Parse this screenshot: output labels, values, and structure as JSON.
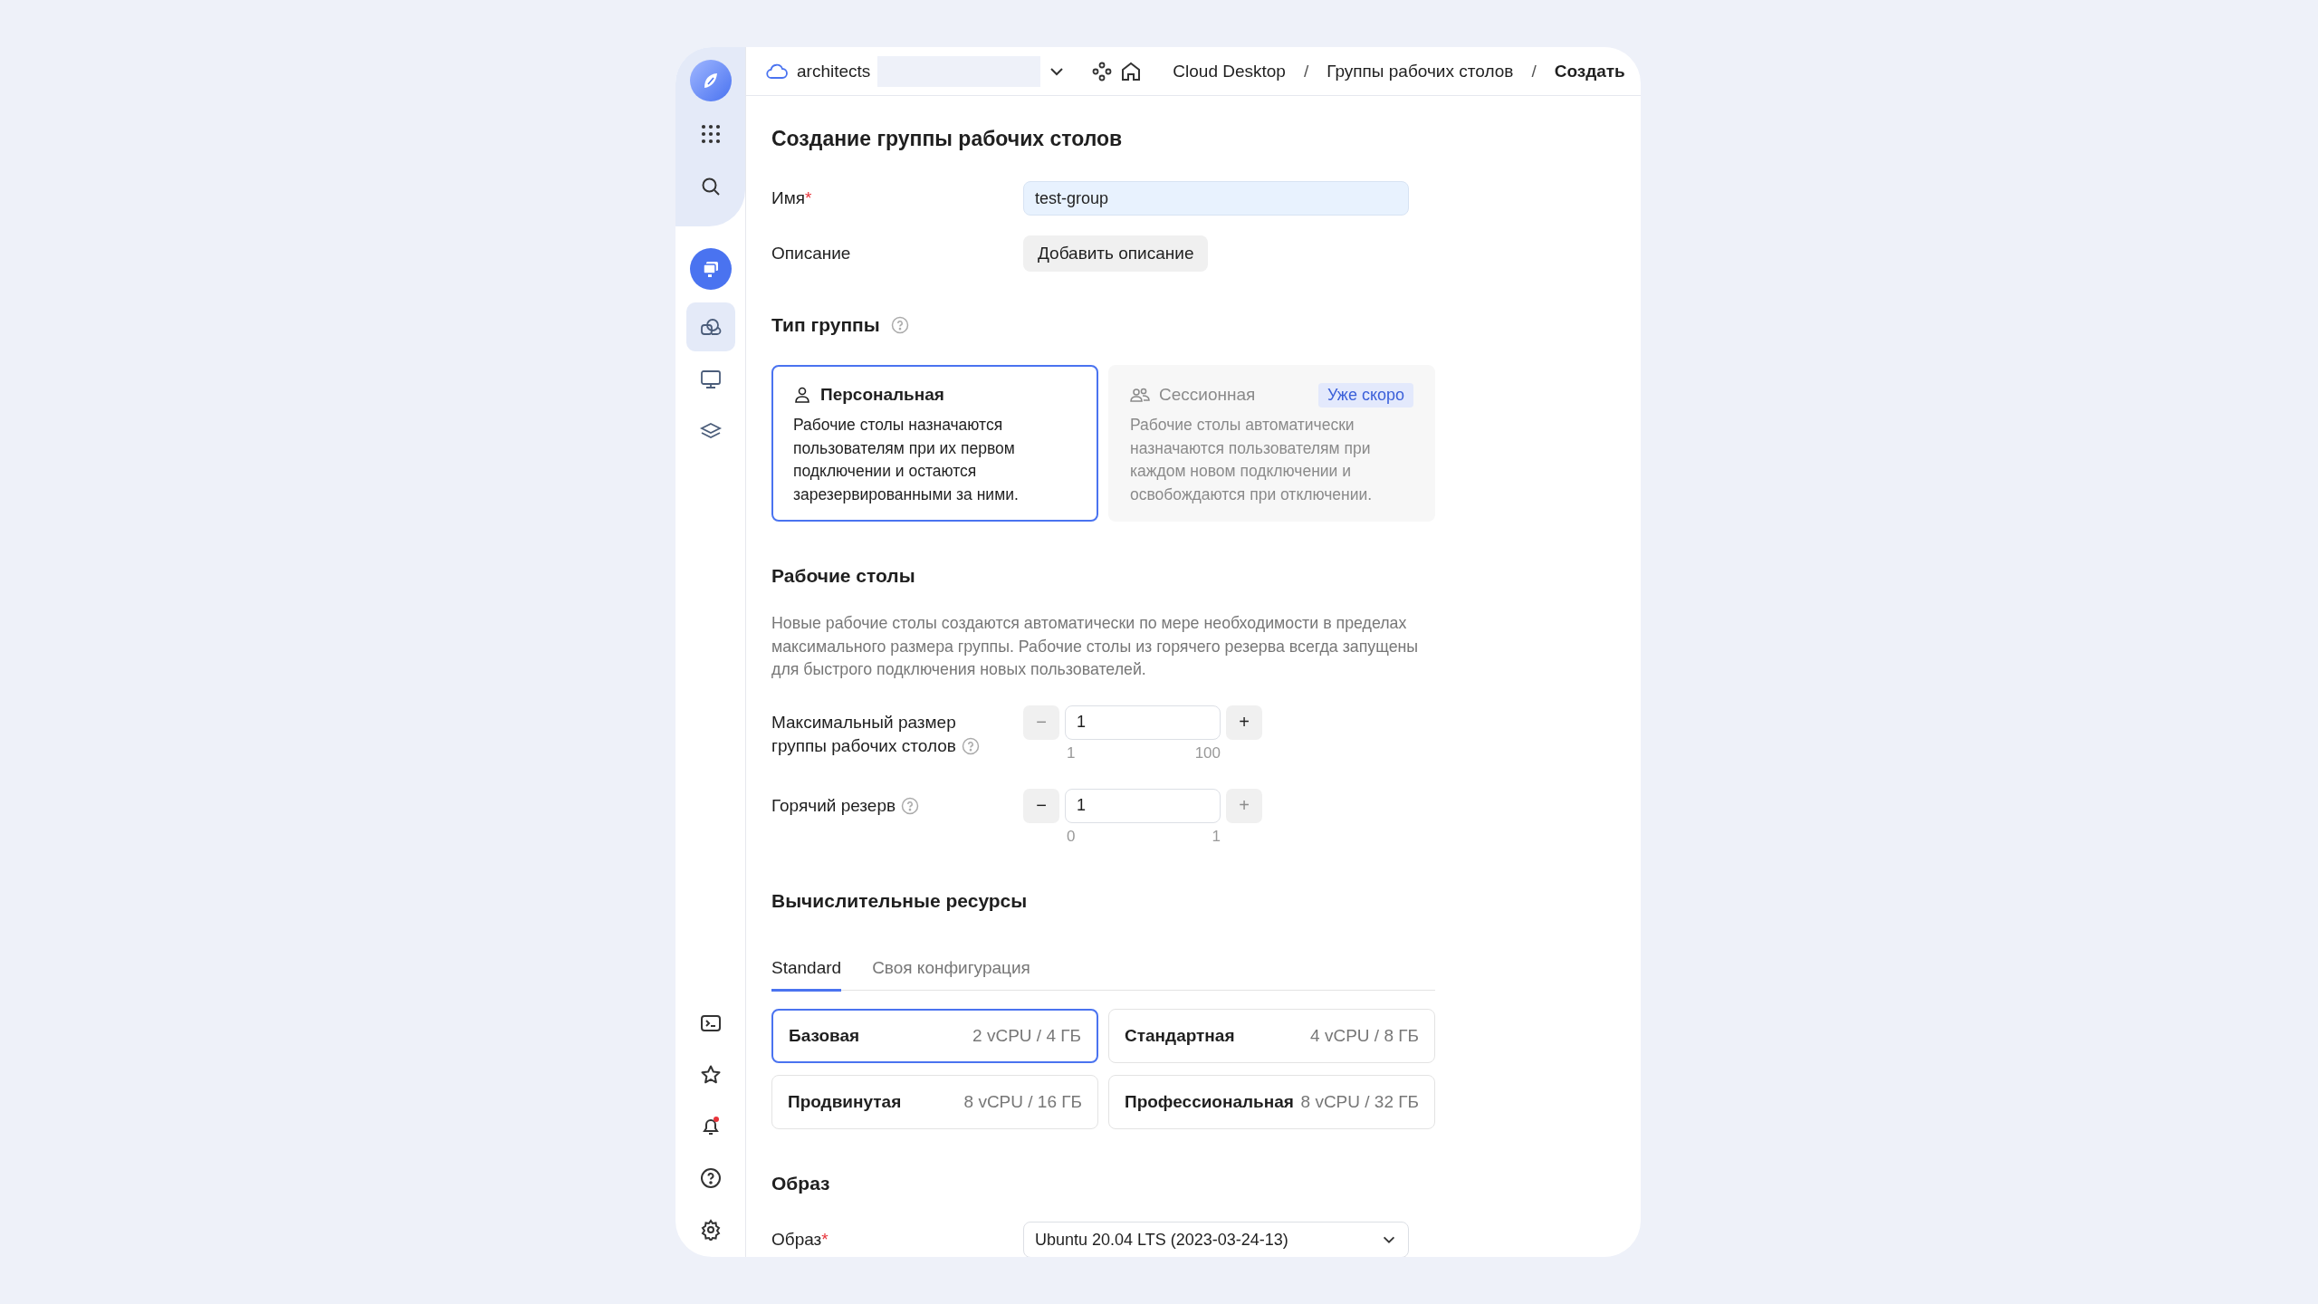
{
  "sidebar": {
    "nav_items": [
      {
        "selected": true
      },
      {
        "selected": false
      },
      {
        "selected": false
      }
    ]
  },
  "top_bar": {
    "folder": "architects",
    "breadcrumbs": [
      {
        "label": "Cloud Desktop",
        "current": false
      },
      {
        "separator": "/",
        "label": "Группы рабочих столов",
        "current": false
      },
      {
        "separator": "/",
        "label": "Создать",
        "current": true
      }
    ]
  },
  "title": "Создание группы рабочих столов",
  "name_field": {
    "label": "Имя",
    "required_mark": "*",
    "value": "test-group"
  },
  "description_field": {
    "label": "Описание",
    "button": "Добавить описание"
  },
  "group_type": {
    "title": "Тип группы",
    "options": [
      {
        "title": "Персональная",
        "description": "Рабочие столы назначаются пользователям при их первом подключении и остаются зарезервированными за ними.",
        "selected": true,
        "disabled": false
      },
      {
        "title": "Сессионная",
        "badge": "Уже скоро",
        "description": "Рабочие столы автоматически назначаются пользователям при каждом новом подключении и освобождаются при отключении.",
        "selected": false,
        "disabled": true
      }
    ]
  },
  "desktops": {
    "title": "Рабочие столы",
    "description": "Новые рабочие столы создаются автоматически по мере необходимости в пределах максимального размера группы. Рабочие столы из горячего резерва всегда запущены для быстрого подключения новых пользователей.",
    "steppers": [
      {
        "label": "Максимальный размер группы рабочих столов",
        "value": "1",
        "minus": "−",
        "plus": "+",
        "minus_disabled": true,
        "plus_disabled": false,
        "min_label": "1",
        "max_label": "100"
      },
      {
        "label": "Горячий резерв",
        "value": "1",
        "minus": "−",
        "plus": "+",
        "minus_disabled": false,
        "plus_disabled": true,
        "min_label": "0",
        "max_label": "1"
      }
    ]
  },
  "resources": {
    "title": "Вычислительные ресурсы",
    "tabs": [
      {
        "label": "Standard",
        "selected": true
      },
      {
        "label": "Своя конфигурация",
        "selected": false
      }
    ],
    "presets": [
      {
        "name": "Базовая",
        "spec": "2 vCPU / 4 ГБ",
        "selected": true
      },
      {
        "name": "Стандартная",
        "spec": "4 vCPU / 8 ГБ",
        "selected": false
      },
      {
        "name": "Продвинутая",
        "spec": "8 vCPU / 16 ГБ",
        "selected": false
      },
      {
        "name": "Профессиональная",
        "spec": "8 vCPU / 32 ГБ",
        "selected": false
      }
    ]
  },
  "image": {
    "title": "Образ",
    "label": "Образ",
    "required_mark": "*",
    "value": "Ubuntu 20.04 LTS (2023-03-24-13)"
  }
}
